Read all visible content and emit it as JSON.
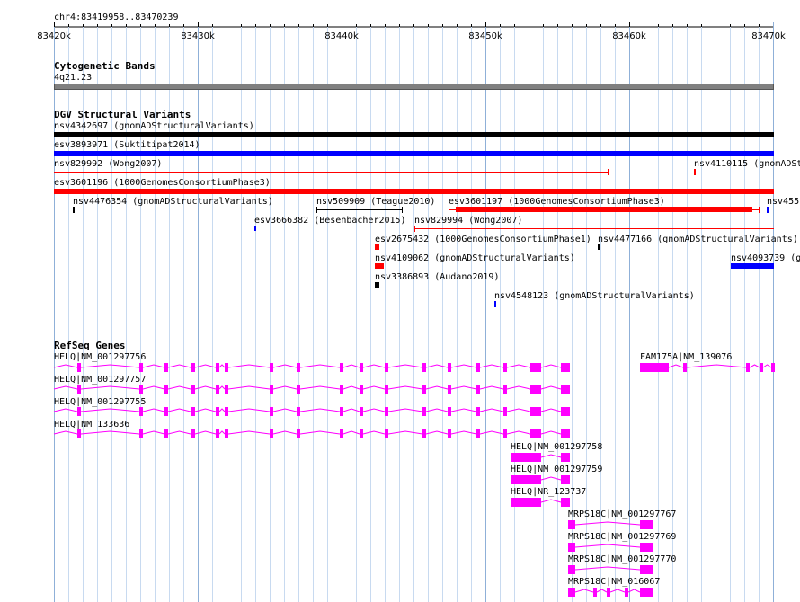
{
  "locus": "chr4:83419958..83470239",
  "ruler": {
    "ticks": [
      "83420k",
      "83430k",
      "83440k",
      "83450k",
      "83460k",
      "83470k"
    ]
  },
  "tracks": {
    "cytobands": {
      "title": "Cytogenetic Bands",
      "band": "4q21.23",
      "color": "#808080"
    },
    "dgv": {
      "title": "DGV Structural Variants",
      "variants": [
        {
          "label": "nsv4342697 (gnomADStructuralVariants)",
          "color": "#000000"
        },
        {
          "label": "esv3893971 (Suktitipat2014)",
          "color": "#0000ff"
        },
        {
          "label": "nsv829992 (Wong2007)",
          "color": "#ff0000"
        },
        {
          "label": "nsv4110115 (gnomADSt",
          "color": "#ff0000"
        },
        {
          "label": "esv3601196 (1000GenomesConsortiumPhase3)",
          "color": "#ff0000"
        },
        {
          "label": "nsv4476354 (gnomADStructuralVariants)",
          "color": "#000000"
        },
        {
          "label": "nsv509909 (Teague2010)",
          "color": "#000000"
        },
        {
          "label": "esv3601197 (1000GenomesConsortiumPhase3)",
          "color": "#ff0000"
        },
        {
          "label": "nsv455",
          "color": "#0000ff"
        },
        {
          "label": "esv3666382 (Besenbacher2015)",
          "color": "#0000ff"
        },
        {
          "label": "nsv829994 (Wong2007)",
          "color": "#ff0000"
        },
        {
          "label": "esv2675432 (1000GenomesConsortiumPhase1)",
          "color": "#ff0000"
        },
        {
          "label": "nsv4477166 (gnomADStructuralVariants)",
          "color": "#000000"
        },
        {
          "label": "nsv4109062 (gnomADStructuralVariants)",
          "color": "#ff0000"
        },
        {
          "label": "nsv4093739 (g",
          "color": "#0000ff"
        },
        {
          "label": "nsv3386893 (Audano2019)",
          "color": "#000000"
        },
        {
          "label": "nsv4548123 (gnomADStructuralVariants)",
          "color": "#0000ff"
        }
      ]
    },
    "refseq": {
      "title": "RefSeq Genes",
      "color": "#ff00ff",
      "genes": [
        {
          "label": "HELQ|NM_001297756"
        },
        {
          "label": "FAM175A|NM_139076"
        },
        {
          "label": "HELQ|NM_001297757"
        },
        {
          "label": "HELQ|NM_001297755"
        },
        {
          "label": "HELQ|NM_133636"
        },
        {
          "label": "HELQ|NM_001297758"
        },
        {
          "label": "HELQ|NM_001297759"
        },
        {
          "label": "HELQ|NR_123737"
        },
        {
          "label": "MRPS18C|NM_001297767"
        },
        {
          "label": "MRPS18C|NM_001297769"
        },
        {
          "label": "MRPS18C|NM_001297770"
        },
        {
          "label": "MRPS18C|NM_016067"
        }
      ]
    }
  }
}
